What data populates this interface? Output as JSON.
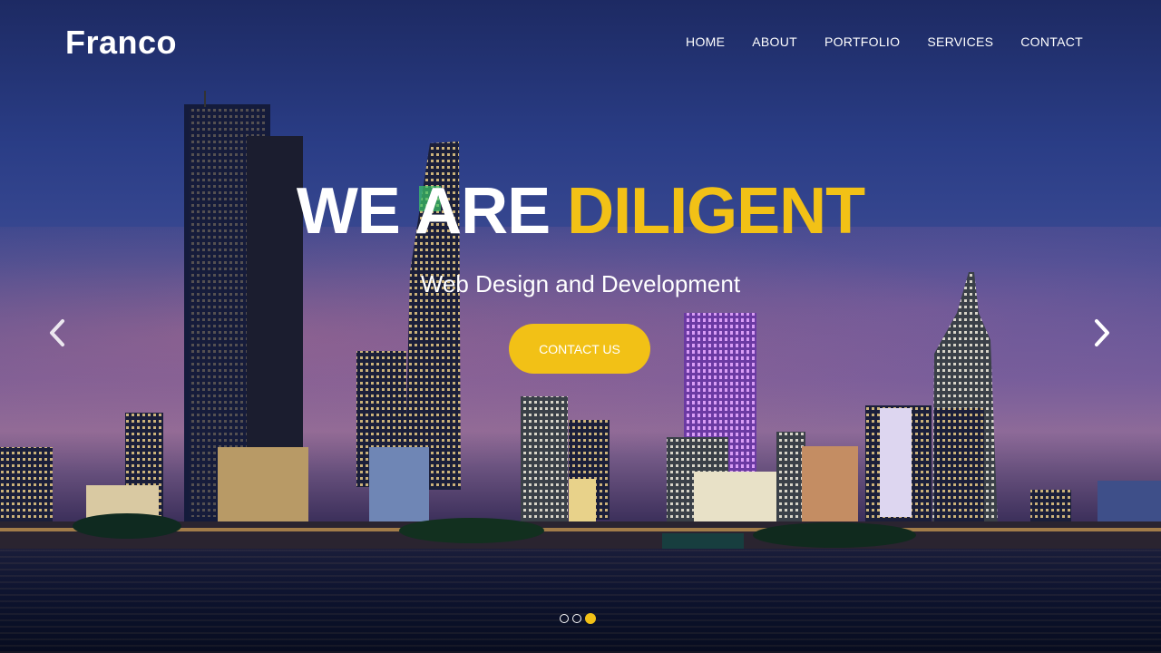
{
  "brand": {
    "logo_text": "Franco"
  },
  "nav": {
    "items": [
      "HOME",
      "ABOUT",
      "PORTFOLIO",
      "SERVICES",
      "CONTACT"
    ]
  },
  "hero": {
    "headline_white": "WE ARE",
    "headline_accent": "DILIGENT",
    "subtitle": "Web Design and Development",
    "cta_label": "CONTACT US"
  },
  "slider": {
    "slides_count": 3,
    "active_slide": 3,
    "prev_icon": "chevron-left-icon",
    "next_icon": "chevron-right-icon"
  },
  "colors": {
    "accent": "#f2c116",
    "text": "#ffffff",
    "sky": "#2a3d86"
  }
}
